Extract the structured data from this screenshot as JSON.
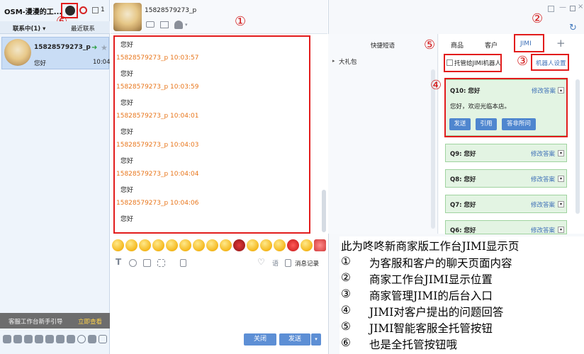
{
  "app": {
    "title": "OSM-漫漫的工...",
    "unread_count": "1"
  },
  "left_tabs": {
    "contacting": "联系中(1) ▾",
    "recent": "最近联系"
  },
  "contact": {
    "name": "15828579273_p",
    "last_message": "您好",
    "time": "10:04"
  },
  "helper": {
    "text": "客服工作台新手引导",
    "link": "立即查看"
  },
  "chat": {
    "header_name": "15828579273_p",
    "messages": [
      {
        "sender": "",
        "text": "您好"
      },
      {
        "sender": "15828579273_p  10:03:57",
        "text": "您好"
      },
      {
        "sender": "15828579273_p  10:03:59",
        "text": "您好"
      },
      {
        "sender": "15828579273_p  10:04:01",
        "text": "您好"
      },
      {
        "sender": "15828579273_p  10:04:03",
        "text": "您好"
      },
      {
        "sender": "15828579273_p  10:04:04",
        "text": "您好"
      },
      {
        "sender": "15828579273_p  10:04:06",
        "text": "您好"
      }
    ],
    "history_label": "消息记录",
    "voice_label": "语",
    "close_label": "关闭",
    "send_label": "发送"
  },
  "right": {
    "quick_phrases": "快捷短语",
    "gift_item": "大礼包",
    "tabs": [
      "商品",
      "客户",
      "JIMI"
    ],
    "plus": "+",
    "trust_label": "托管给JIMI机器人",
    "robot_settings": "机器人设置",
    "qa_items": [
      {
        "q": "Q10: 您好",
        "edit": "修改答案",
        "answer": "您好，欢迎光临本店。"
      },
      {
        "q": "Q9: 您好",
        "edit": "修改答案"
      },
      {
        "q": "Q8: 您好",
        "edit": "修改答案"
      },
      {
        "q": "Q7: 您好",
        "edit": "修改答案"
      },
      {
        "q": "Q6: 您好",
        "edit": "修改答案"
      }
    ],
    "qa_buttons": [
      "发送",
      "引用",
      "答非所问"
    ]
  },
  "annotations": [
    "①",
    "②",
    "③",
    "④",
    "⑤",
    "⑥"
  ],
  "caption": {
    "title": "此为咚咚新商家版工作台JIMI显示页",
    "lines": [
      {
        "num": "①",
        "text": "为客服和客户的聊天页面内容"
      },
      {
        "num": "②",
        "text": "商家工作台JIMI显示位置"
      },
      {
        "num": "③",
        "text": "商家管理JIMI的后台入口"
      },
      {
        "num": "④",
        "text": "JIMI对客户提出的问题回答"
      },
      {
        "num": "⑤",
        "text": "JIMI智能客服全托管按钮"
      },
      {
        "num": "⑥",
        "text": "也是全托管按钮哦"
      }
    ]
  }
}
